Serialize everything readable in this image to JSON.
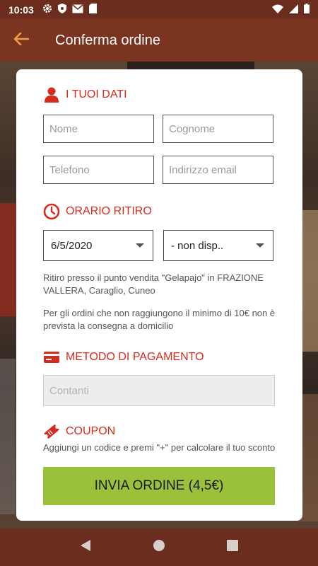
{
  "status_bar": {
    "time": "10:03",
    "left_icons": [
      "gear-icon",
      "shield-icon",
      "mail-icon",
      "sd-card-icon"
    ],
    "right_icons": [
      "wifi-icon",
      "signal-icon",
      "battery-icon"
    ]
  },
  "app_bar": {
    "title": "Conferma ordine",
    "back_icon": "arrow-left-icon",
    "accent": "#f0a03a",
    "background": "#7a3420"
  },
  "sections": {
    "personal": {
      "heading": "I TUOI DATI",
      "icon": "user-icon",
      "fields": {
        "name_placeholder": "Nome",
        "surname_placeholder": "Cognome",
        "phone_placeholder": "Telefono",
        "email_placeholder": "Indirizzo email"
      }
    },
    "pickup": {
      "heading": "ORARIO RITIRO",
      "icon": "clock-icon",
      "date_value": "6/5/2020",
      "time_value": "- non disp..",
      "location_note": "Ritiro presso il punto vendita \"Gelapajo\" in FRAZIONE VALLERA, Caraglio, Cuneo",
      "delivery_note": "Per gli ordini che non raggiungono il minimo di 10€ non è prevista la consegna a domicilio"
    },
    "payment": {
      "heading": "METODO DI PAGAMENTO",
      "icon": "credit-card-icon",
      "method_placeholder": "Contanti"
    },
    "coupon": {
      "heading": "COUPON",
      "icon": "ticket-icon",
      "note": "Aggiungi un codice e premi \"+\" per calcolare il tuo sconto"
    }
  },
  "submit": {
    "label": "INVIA ORDINE (4,5€)",
    "color": "#9bc13b"
  },
  "accent_red": "#d42b1e",
  "nav_bar": {
    "buttons": [
      "back-triangle-icon",
      "home-circle-icon",
      "recents-square-icon"
    ]
  }
}
